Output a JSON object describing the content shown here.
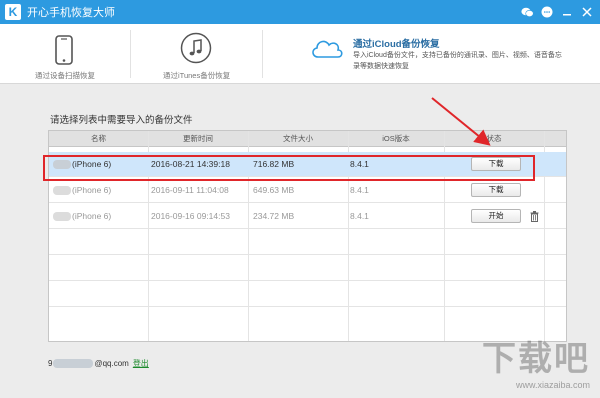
{
  "app": {
    "title": "开心手机恢复大师",
    "logo_letter": "K"
  },
  "titlebar_icons": [
    "wechat-icon",
    "chat-bubble-icon",
    "minimize-icon",
    "close-icon"
  ],
  "modes": [
    {
      "label": "通过设备扫描恢复",
      "icon": "phone-icon"
    },
    {
      "label": "通过iTunes备份恢复",
      "icon": "music-note-icon"
    },
    {
      "title": "通过iCloud备份恢复",
      "desc": "导入iCloud备份文件，支持已备份的通讯录、图片、视频、语音备忘录等数据快速恢复",
      "icon": "cloud-icon",
      "active": true
    }
  ],
  "panel": {
    "title": "请选择列表中需要导入的备份文件"
  },
  "table": {
    "headers": [
      "名称",
      "更新时间",
      "文件大小",
      "iOS版本",
      "状态"
    ],
    "rows": [
      {
        "name": "iPhone 6)",
        "time": "2016-08-21 14:39:18",
        "size": "716.82 MB",
        "ios": "8.4.1",
        "action": "下载",
        "selected": true
      },
      {
        "name": "iPhone 6)",
        "time": "2016-09-11 11:04:08",
        "size": "649.63 MB",
        "ios": "8.4.1",
        "action": "下载",
        "selected": false
      },
      {
        "name": "iPhone 6)",
        "time": "2016-09-16 09:14:53",
        "size": "234.72 MB",
        "ios": "8.4.1",
        "action": "开始",
        "selected": false
      }
    ]
  },
  "account": {
    "prefix": "9",
    "suffix": "@qq.com",
    "logout": "登出"
  },
  "watermark": {
    "big": "下载吧",
    "small": "www.xiazaiba.com"
  },
  "colors": {
    "titlebar": "#2d9ae0",
    "selected_row": "#cfe6fb",
    "highlight": "#e0262a"
  }
}
